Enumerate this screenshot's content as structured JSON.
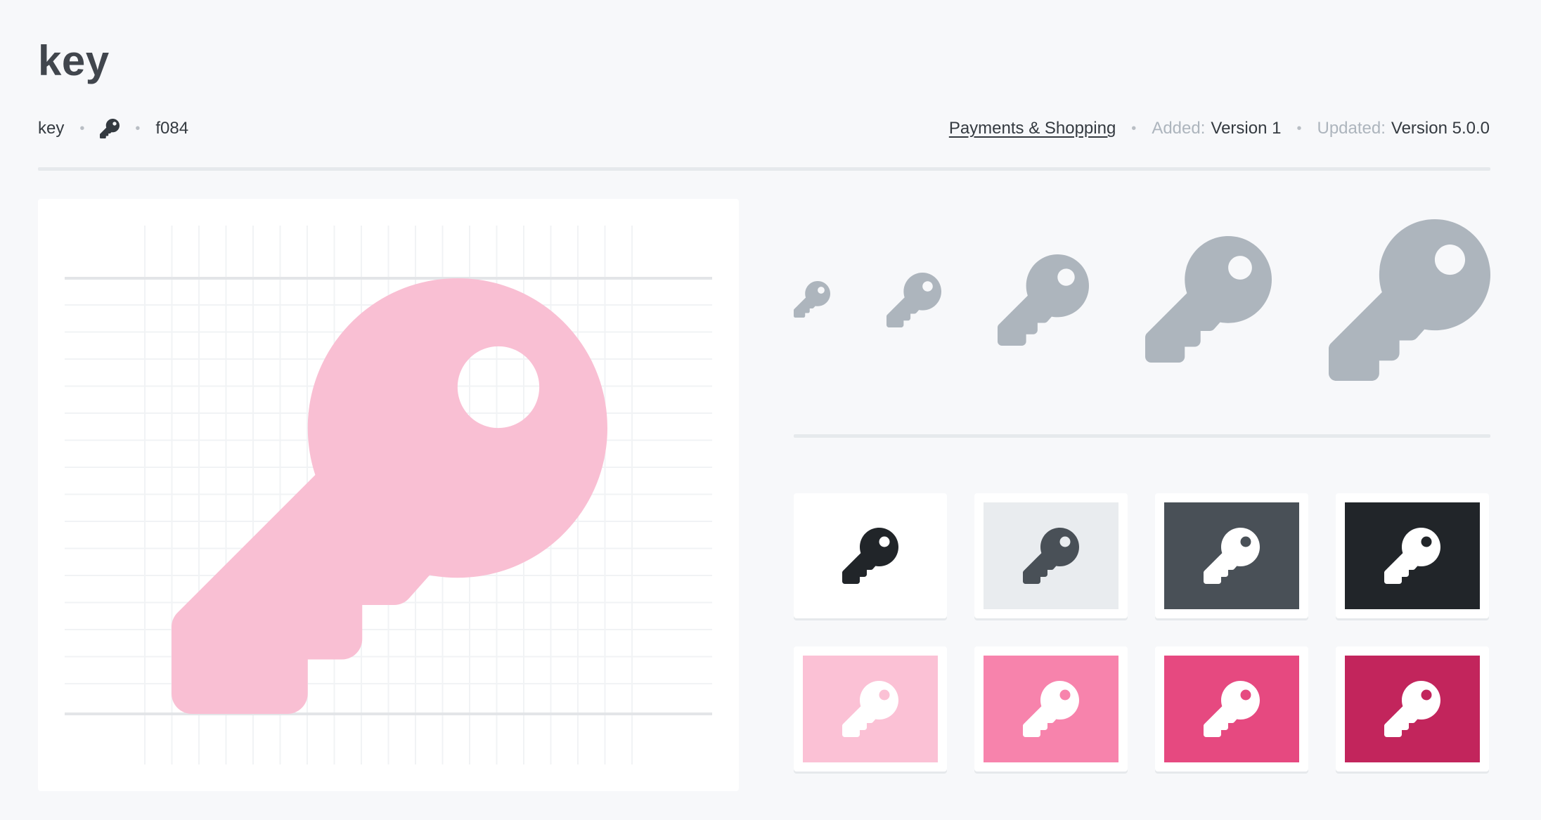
{
  "icon": {
    "name": "key",
    "unicode": "f084",
    "category": "Payments & Shopping",
    "added_label": "Added:",
    "added_value": "Version 1",
    "updated_label": "Updated:",
    "updated_value": "Version 5.0.0",
    "separator": "•"
  },
  "colors": {
    "preview_pink": "#f9bfd3",
    "size_gray": "#adb5bd",
    "text": "#343a40",
    "muted": "#adb5bd"
  },
  "swatches": [
    {
      "name": "white",
      "bg": "#ffffff",
      "fg": "#212529",
      "hole": "#ffffff"
    },
    {
      "name": "light-gray",
      "bg": "#e9ecef",
      "fg": "#495057",
      "hole": "#e9ecef"
    },
    {
      "name": "dark-gray",
      "bg": "#495057",
      "fg": "#ffffff",
      "hole": "#495057"
    },
    {
      "name": "black",
      "bg": "#212529",
      "fg": "#ffffff",
      "hole": "#212529"
    },
    {
      "name": "pink-light",
      "bg": "#fbc1d5",
      "fg": "#ffffff",
      "hole": "#fbc1d5"
    },
    {
      "name": "pink",
      "bg": "#f783ac",
      "fg": "#ffffff",
      "hole": "#f783ac"
    },
    {
      "name": "pink-dark",
      "bg": "#e64980",
      "fg": "#ffffff",
      "hole": "#e64980"
    },
    {
      "name": "pink-darker",
      "bg": "#c2255c",
      "fg": "#ffffff",
      "hole": "#c2255c"
    }
  ]
}
